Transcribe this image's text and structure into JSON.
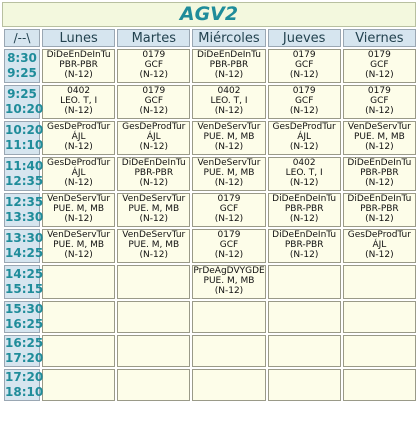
{
  "title": "AGV2",
  "corner_label": "/--\\",
  "days": [
    "Lunes",
    "Martes",
    "Miércoles",
    "Jueves",
    "Viernes"
  ],
  "rows": [
    {
      "start": "8:30",
      "end": "9:25",
      "cells": [
        [
          "DiDeEnDeInTu",
          "PBR-PBR",
          "(N-12)"
        ],
        [
          "0179",
          "GCF",
          "(N-12)"
        ],
        [
          "DiDeEnDeInTu",
          "PBR-PBR",
          "(N-12)"
        ],
        [
          "0179",
          "GCF",
          "(N-12)"
        ],
        [
          "0179",
          "GCF",
          "(N-12)"
        ]
      ]
    },
    {
      "start": "9:25",
      "end": "10:20",
      "cells": [
        [
          "0402",
          "LEO. T, I",
          "(N-12)"
        ],
        [
          "0179",
          "GCF",
          "(N-12)"
        ],
        [
          "0402",
          "LEO. T, I",
          "(N-12)"
        ],
        [
          "0179",
          "GCF",
          "(N-12)"
        ],
        [
          "0179",
          "GCF",
          "(N-12)"
        ]
      ]
    },
    {
      "start": "10:20",
      "end": "11:10",
      "cells": [
        [
          "GesDeProdTur",
          "ÁJL",
          "(N-12)"
        ],
        [
          "GesDeProdTur",
          "ÁJL",
          "(N-12)"
        ],
        [
          "VenDeServTur",
          "PUE. M, MB",
          "(N-12)"
        ],
        [
          "GesDeProdTur",
          "ÁJL",
          "(N-12)"
        ],
        [
          "VenDeServTur",
          "PUE. M, MB",
          "(N-12)"
        ]
      ]
    },
    {
      "start": "11:40",
      "end": "12:35",
      "cells": [
        [
          "GesDeProdTur",
          "ÁJL",
          "(N-12)"
        ],
        [
          "DiDeEnDeInTu",
          "PBR-PBR",
          "(N-12)"
        ],
        [
          "VenDeServTur",
          "PUE. M, MB",
          "(N-12)"
        ],
        [
          "0402",
          "LEO. T, I",
          "(N-12)"
        ],
        [
          "DiDeEnDeInTu",
          "PBR-PBR",
          "(N-12)"
        ]
      ]
    },
    {
      "start": "12:35",
      "end": "13:30",
      "cells": [
        [
          "VenDeServTur",
          "PUE. M, MB",
          "(N-12)"
        ],
        [
          "VenDeServTur",
          "PUE. M, MB",
          "(N-12)"
        ],
        [
          "0179",
          "GCF",
          "(N-12)"
        ],
        [
          "DiDeEnDeInTu",
          "PBR-PBR",
          "(N-12)"
        ],
        [
          "DiDeEnDeInTu",
          "PBR-PBR",
          "(N-12)"
        ]
      ]
    },
    {
      "start": "13:30",
      "end": "14:25",
      "cells": [
        [
          "VenDeServTur",
          "PUE. M, MB",
          "(N-12)"
        ],
        [
          "VenDeServTur",
          "PUE. M, MB",
          "(N-12)"
        ],
        [
          "0179",
          "GCF",
          "(N-12)"
        ],
        [
          "DiDeEnDeInTu",
          "PBR-PBR",
          "(N-12)"
        ],
        [
          "GesDeProdTur",
          "ÁJL",
          "(N-12)"
        ]
      ]
    },
    {
      "start": "14:25",
      "end": "15:15",
      "cells": [
        [],
        [],
        [
          "PrDeAgDVYGDE",
          "PUE. M, MB",
          "(N-12)"
        ],
        [],
        []
      ]
    },
    {
      "start": "15:30",
      "end": "16:25",
      "cells": [
        [],
        [],
        [],
        [],
        []
      ]
    },
    {
      "start": "16:25",
      "end": "17:20",
      "cells": [
        [],
        [],
        [],
        [],
        []
      ]
    },
    {
      "start": "17:20",
      "end": "18:10",
      "cells": [
        [],
        [],
        [],
        [],
        []
      ]
    }
  ]
}
